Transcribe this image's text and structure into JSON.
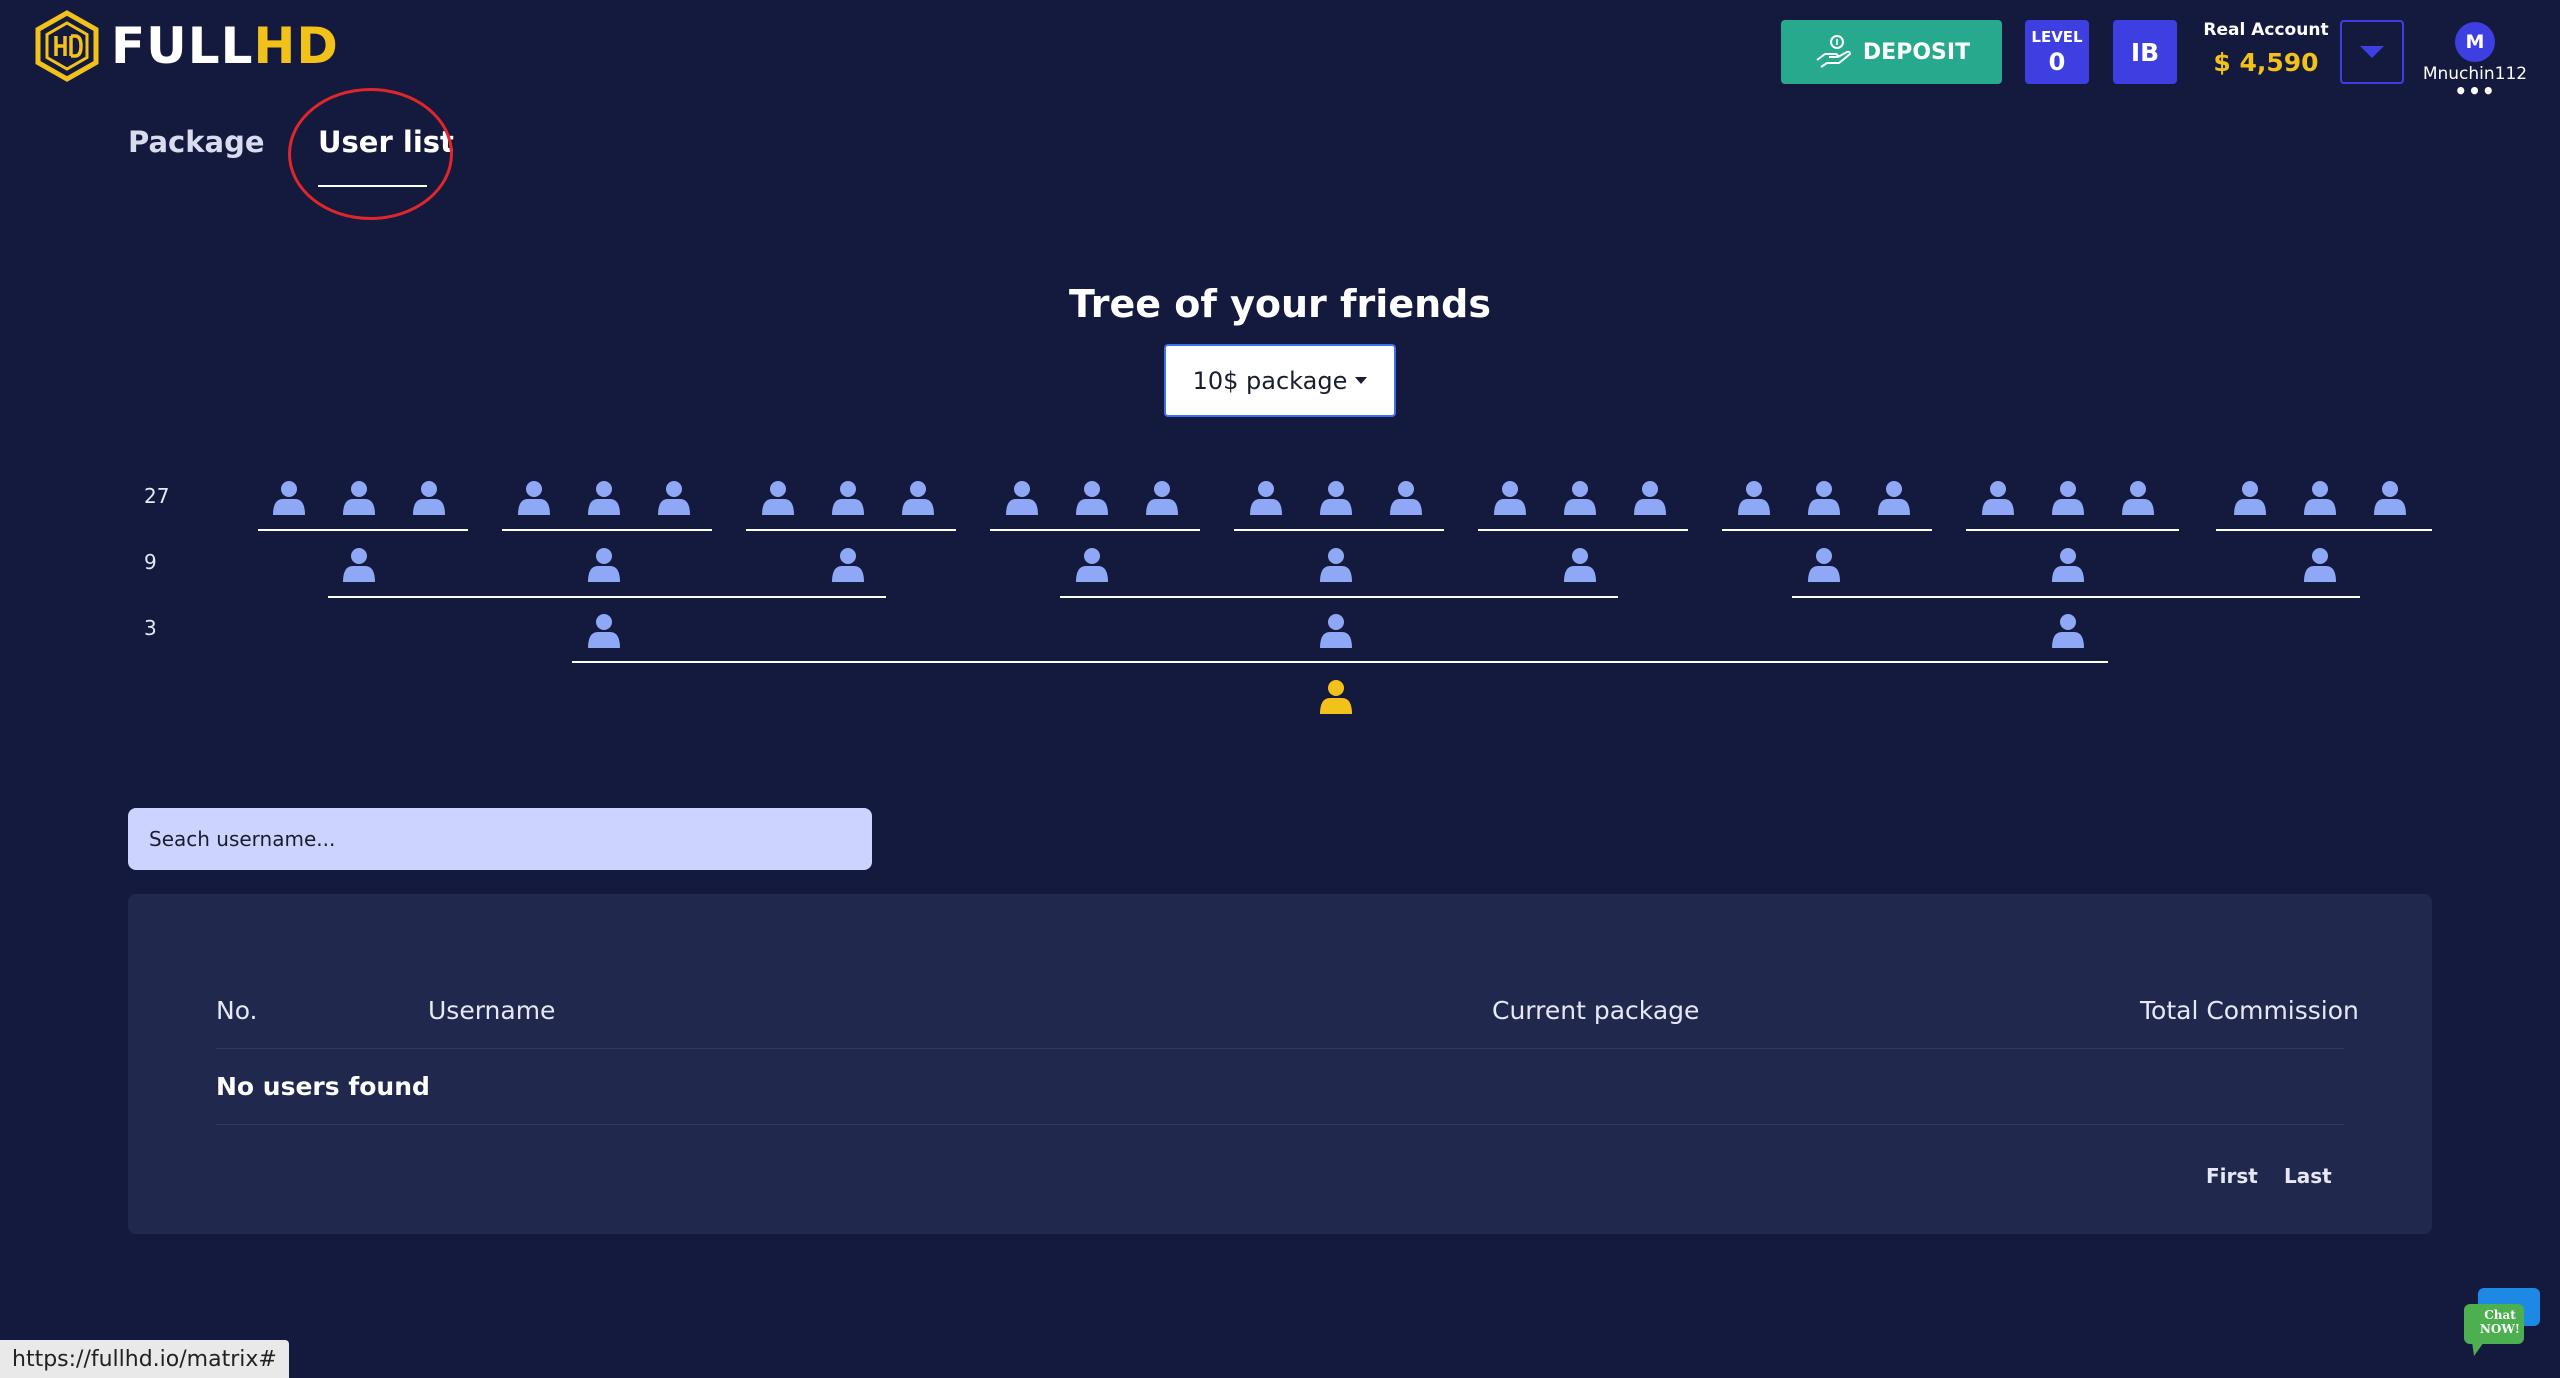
{
  "header": {
    "logo": {
      "text_white": "FULL",
      "text_yellow": "HD",
      "brand_color": "#f2c21b"
    },
    "deposit_label": "DEPOSIT",
    "level": {
      "label": "LEVEL",
      "value": "0"
    },
    "ib_label": "IB",
    "account": {
      "type": "Real Account",
      "balance": "$ 4,590"
    },
    "user": {
      "initial": "M",
      "username": "Mnuchin112",
      "more": "•••"
    }
  },
  "tabs": [
    {
      "label": "Package",
      "active": false
    },
    {
      "label": "User list",
      "active": true
    }
  ],
  "tree": {
    "title": "Tree of your friends",
    "package_selected": "10$ package",
    "row_labels": [
      "27",
      "9",
      "3"
    ],
    "levels": [
      27,
      9,
      3,
      1
    ],
    "member_color": "#8fa8f5",
    "root_color": "#f2c21b"
  },
  "search": {
    "placeholder": "Seach username..."
  },
  "table": {
    "columns": [
      "No.",
      "Username",
      "Current package",
      "Total Commission"
    ],
    "empty_message": "No users found",
    "pagination": {
      "first": "First",
      "last": "Last"
    }
  },
  "status_bar": {
    "url": "https://fullhd.io/matrix#"
  },
  "chat": {
    "line1": "Chat",
    "line2": "NOW!"
  },
  "colors": {
    "background": "#141a3d",
    "card": "#20284e",
    "deposit": "#26a98d",
    "accent": "#3e3fe0",
    "highlight_circle": "#e0262b"
  }
}
